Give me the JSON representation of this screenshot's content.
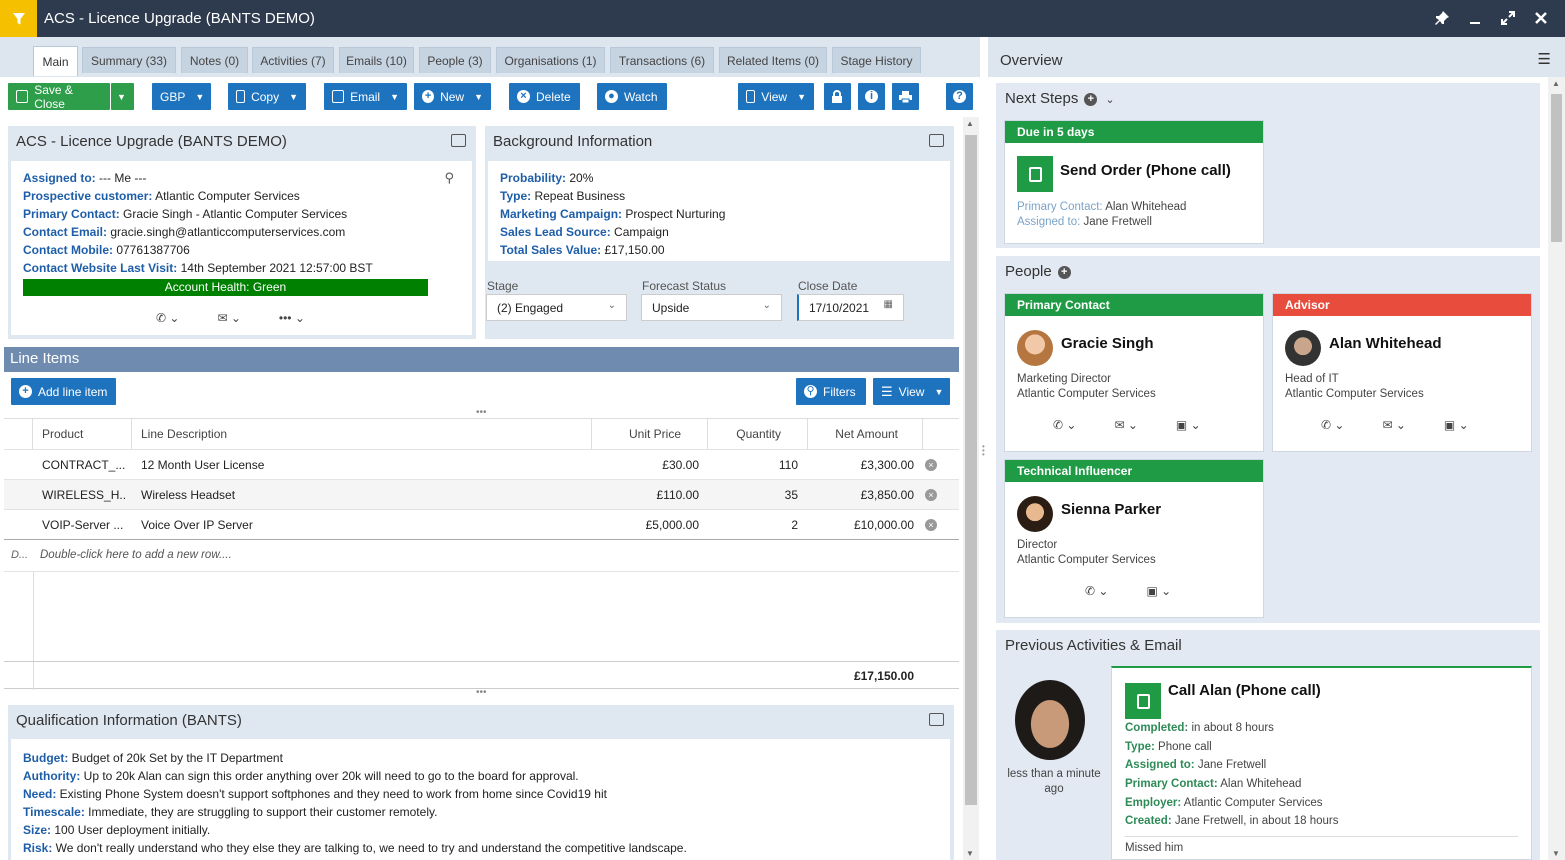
{
  "window": {
    "title": "ACS - Licence Upgrade (BANTS DEMO)"
  },
  "tabs": [
    {
      "label": "Main"
    },
    {
      "label": "Summary (33)"
    },
    {
      "label": "Notes (0)"
    },
    {
      "label": "Activities (7)"
    },
    {
      "label": "Emails (10)"
    },
    {
      "label": "People (3)"
    },
    {
      "label": "Organisations (1)"
    },
    {
      "label": "Transactions (6)"
    },
    {
      "label": "Related Items (0)"
    },
    {
      "label": "Stage History"
    }
  ],
  "toolbar": {
    "save_close": "Save & Close",
    "currency": "GBP",
    "copy": "Copy",
    "email": "Email",
    "new": "New",
    "delete": "Delete",
    "watch": "Watch",
    "view": "View"
  },
  "summary_panel": {
    "title": "ACS - Licence Upgrade (BANTS DEMO)",
    "fields": [
      {
        "label": "Assigned to:",
        "value": " --- Me ---"
      },
      {
        "label": "Prospective customer:",
        "value": " Atlantic Computer Services"
      },
      {
        "label": "Primary Contact:",
        "value": " Gracie Singh - Atlantic Computer Services"
      },
      {
        "label": "Contact Email:",
        "value": " gracie.singh@atlanticcomputerservices.com"
      },
      {
        "label": "Contact Mobile:",
        "value": " 07761387706"
      },
      {
        "label": "Contact Website Last Visit:",
        "value": " 14th September 2021 12:57:00 BST"
      }
    ],
    "health": "Account Health: Green"
  },
  "background_panel": {
    "title": "Background Information",
    "fields": [
      {
        "label": "Probability:",
        "value": " 20%"
      },
      {
        "label": "Type:",
        "value": " Repeat Business"
      },
      {
        "label": "Marketing Campaign:",
        "value": " Prospect Nurturing"
      },
      {
        "label": "Sales Lead Source:",
        "value": " Campaign"
      },
      {
        "label": "Total Sales Value:",
        "value": " £17,150.00"
      }
    ],
    "stage_label": "Stage",
    "stage_value": "(2) Engaged",
    "forecast_label": "Forecast Status",
    "forecast_value": "Upside",
    "close_label": "Close Date",
    "close_value": "17/10/2021"
  },
  "line_items": {
    "title": "Line Items",
    "add_label": "Add line item",
    "filters_label": "Filters",
    "view_label": "View",
    "columns": [
      "Product",
      "Line Description",
      "Unit Price",
      "Quantity",
      "Net Amount"
    ],
    "rows": [
      {
        "product": "CONTRACT_...",
        "desc": "12 Month User License",
        "price": "£30.00",
        "qty": "110",
        "net": "£3,300.00"
      },
      {
        "product": "WIRELESS_H...",
        "desc": "Wireless Headset",
        "price": "£110.00",
        "qty": "35",
        "net": "£3,850.00"
      },
      {
        "product": "VOIP-Server ...",
        "desc": "Voice Over IP Server",
        "price": "£5,000.00",
        "qty": "2",
        "net": "£10,000.00"
      }
    ],
    "new_row_marker": "D...",
    "new_row_hint": "Double-click here to add a new row....",
    "total": "£17,150.00"
  },
  "qualification": {
    "title": "Qualification Information (BANTS)",
    "fields": [
      {
        "label": "Budget:",
        "value": " Budget of 20k Set by the IT Department"
      },
      {
        "label": "Authority:",
        "value": " Up to 20k Alan can sign this order anything over 20k will need to go to the board for approval."
      },
      {
        "label": "Need:",
        "value": " Existing Phone System doesn't support softphones and they need to work from home since Covid19 hit"
      },
      {
        "label": "Timescale:",
        "value": " Immediate, they are struggling to support their customer remotely."
      },
      {
        "label": "Size:",
        "value": " 100 User deployment initially."
      },
      {
        "label": "Risk:",
        "value": " We don't really understand who they else they are talking to, we need to try and understand the competitive landscape."
      }
    ]
  },
  "overview": {
    "title": "Overview",
    "next_steps": {
      "title": "Next Steps",
      "due": "Due in 5 days",
      "task": "Send Order (Phone call)",
      "primary_label": "Primary Contact:",
      "primary_value": " Alan Whitehead",
      "assigned_label": "Assigned to:",
      "assigned_value": " Jane Fretwell"
    },
    "people": {
      "title": "People",
      "cards": [
        {
          "role": "Primary Contact",
          "name": "Gracie Singh",
          "job": "Marketing Director",
          "org": "Atlantic Computer Services"
        },
        {
          "role": "Advisor",
          "name": "Alan Whitehead",
          "job": "Head of IT",
          "org": "Atlantic Computer Services"
        },
        {
          "role": "Technical Influencer",
          "name": "Sienna Parker",
          "job": "Director",
          "org": "Atlantic Computer Services"
        }
      ]
    },
    "previous": {
      "title": "Previous Activities & Email",
      "time": "less than a minute ago",
      "activity_title": "Call Alan (Phone call)",
      "fields": [
        {
          "label": "Completed:",
          "value": " in about 8 hours"
        },
        {
          "label": "Type:",
          "value": " Phone call"
        },
        {
          "label": "Assigned to:",
          "value": " Jane Fretwell"
        },
        {
          "label": "Primary Contact:",
          "value": " Alan Whitehead"
        },
        {
          "label": "Employer:",
          "value": " Atlantic Computer Services"
        },
        {
          "label": "Created:",
          "value": " Jane Fretwell, in about 18 hours"
        }
      ],
      "note": "Missed him"
    }
  },
  "colors": {
    "primary": "#1e73be",
    "success": "#2e9e4b",
    "danger": "#e74c3c",
    "titlebar": "#2e3b4e",
    "accent": "#f5c000"
  }
}
